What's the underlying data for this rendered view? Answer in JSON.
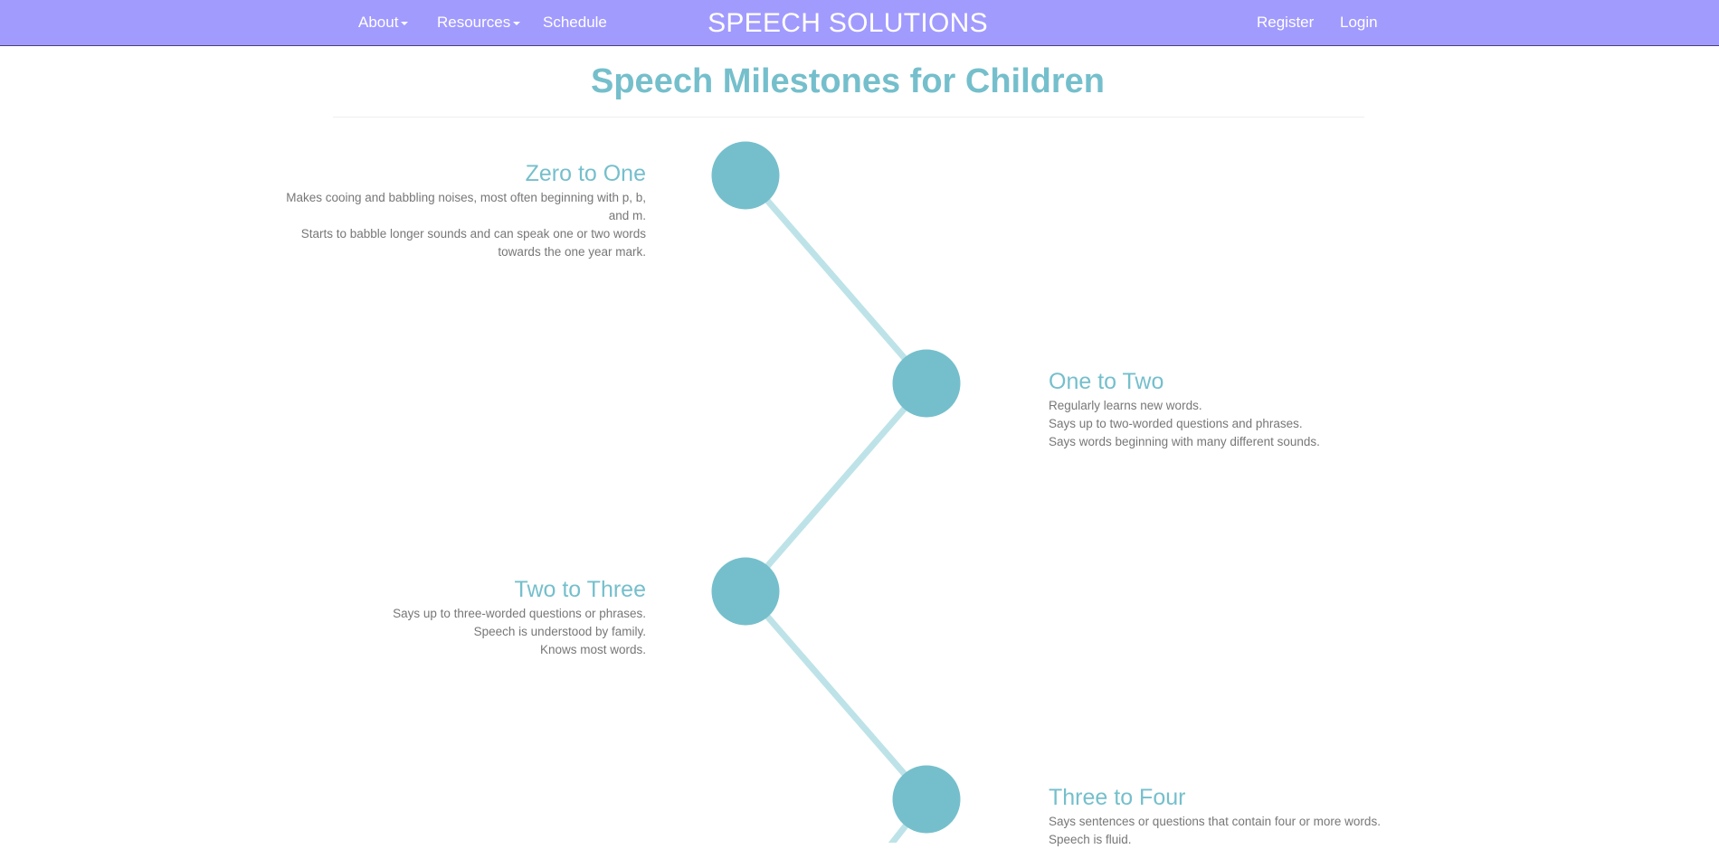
{
  "navbar": {
    "brand": "SPEECH SOLUTIONS",
    "left_links": [
      {
        "label": "About",
        "dropdown": true
      },
      {
        "label": "Resources",
        "dropdown": true
      },
      {
        "label": "Schedule",
        "dropdown": false
      }
    ],
    "right_links": [
      {
        "label": "Register"
      },
      {
        "label": "Login"
      }
    ]
  },
  "page": {
    "title": "Speech Milestones for Children"
  },
  "milestones": [
    {
      "title": "Zero to One",
      "lines": [
        "Makes cooing and babbling noises, most often beginning with p, b, and m.",
        "Starts to babble longer sounds and can speak one or two words towards the one year mark."
      ]
    },
    {
      "title": "One to Two",
      "lines": [
        "Regularly learns new words.",
        "Says up to two-worded questions and phrases.",
        "Says words beginning with many different sounds."
      ]
    },
    {
      "title": "Two to Three",
      "lines": [
        "Says up to three-worded questions or phrases.",
        "Speech is understood by family.",
        "Knows most words."
      ]
    },
    {
      "title": "Three to Four",
      "lines": [
        "Says sentences or questions that contain four or more words.",
        "Speech is fluid."
      ]
    }
  ],
  "colors": {
    "navbar_bg": "#a29bfe",
    "accent": "#75bfcc",
    "connector": "#bde3e8",
    "body_text": "#777777"
  }
}
